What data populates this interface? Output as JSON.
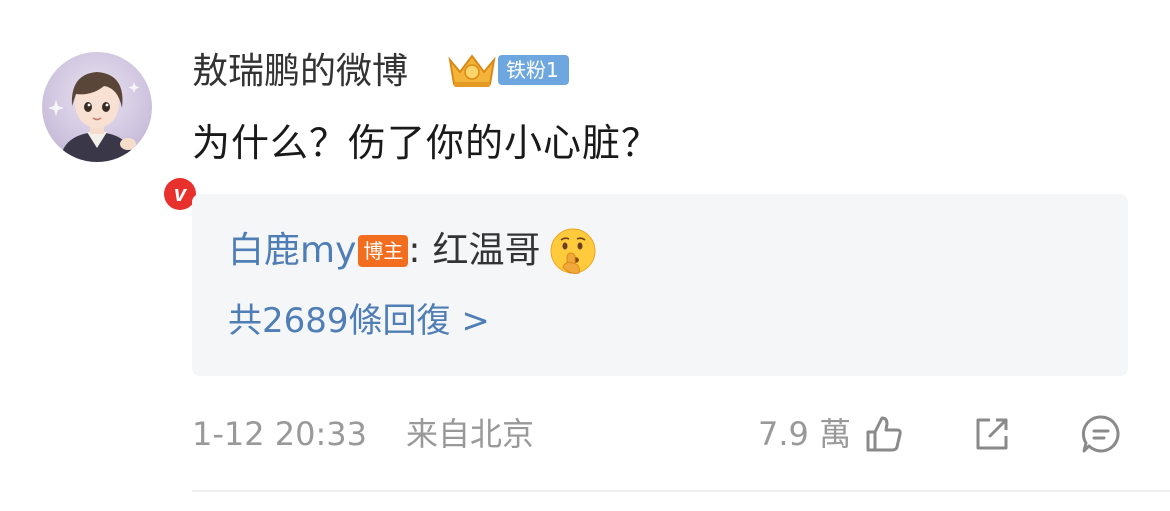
{
  "comment": {
    "username": "敖瑞鹏的微博",
    "fan_badge": "铁粉1",
    "text": "为什么？伤了你的小心脏？"
  },
  "reply_preview": {
    "user": "白鹿my",
    "role_tag": "博主",
    "colon": ":",
    "text": "红温哥",
    "emoji": "shushing-face-emoji",
    "total_replies": "共2689條回復 >"
  },
  "meta": {
    "time": "1-12 20:33",
    "location": "来自北京",
    "likes": "7.9 萬"
  },
  "icons": {
    "like": "thumbs-up-icon",
    "share": "share-icon",
    "comment": "comment-icon"
  },
  "colors": {
    "link_blue": "#4f7db5",
    "badge_blue": "#6ea7e0",
    "blogger_orange": "#f36d1e",
    "verified_red": "#e8312c",
    "muted_gray": "#999999"
  }
}
